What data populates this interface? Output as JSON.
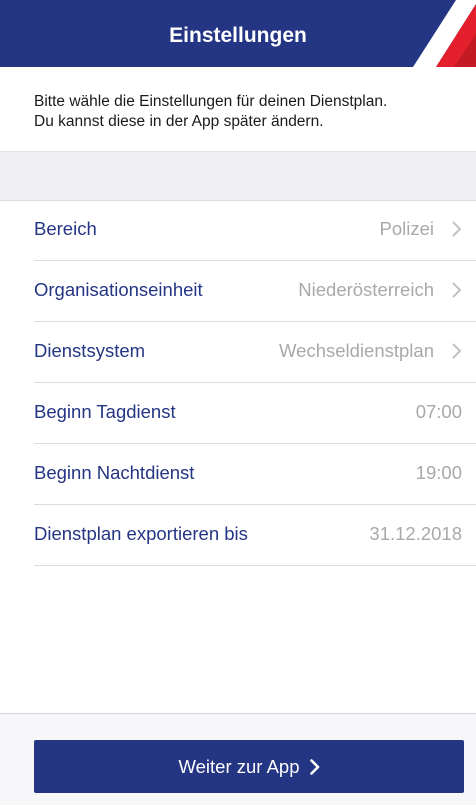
{
  "header": {
    "title": "Einstellungen",
    "colors": {
      "background": "#243583",
      "flag_white": "#ffffff",
      "flag_red": "#e3202b"
    }
  },
  "intro": {
    "line1": "Bitte wähle die Einstellungen für deinen Dienstplan.",
    "line2": "Du kannst diese in der App später ändern."
  },
  "settings": [
    {
      "label": "Bereich",
      "value": "Polizei",
      "chevron": true
    },
    {
      "label": "Organisationseinheit",
      "value": "Niederösterreich",
      "chevron": true
    },
    {
      "label": "Dienstsystem",
      "value": "Wechseldienstplan",
      "chevron": true
    },
    {
      "label": "Beginn Tagdienst",
      "value": "07:00",
      "chevron": false
    },
    {
      "label": "Beginn Nachtdienst",
      "value": "19:00",
      "chevron": false
    },
    {
      "label": "Dienstplan exportieren bis",
      "value": "31.12.2018",
      "chevron": false
    }
  ],
  "footer": {
    "continue_label": "Weiter zur App"
  },
  "icons": {
    "row_chevron": "chevron-right-icon",
    "button_chevron": "chevron-right-icon"
  }
}
